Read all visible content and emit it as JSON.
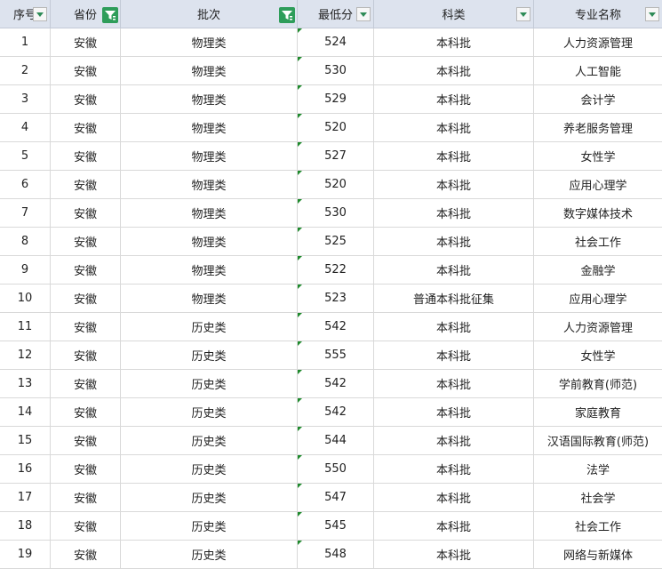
{
  "headers": [
    {
      "label": "序号",
      "control": "dropdown"
    },
    {
      "label": "省份",
      "control": "filter"
    },
    {
      "label": "批次",
      "control": "filter"
    },
    {
      "label": "最低分",
      "control": "dropdown"
    },
    {
      "label": "科类",
      "control": "dropdown"
    },
    {
      "label": "专业名称",
      "control": "dropdown"
    }
  ],
  "icons": {
    "dropdown": "dropdown-arrow-icon",
    "filter": "filter-active-icon"
  },
  "colors": {
    "header_bg": "#dde3ee",
    "filter_green": "#2e9d5a",
    "number_marker": "#1e8a2c"
  },
  "rows": [
    [
      "1",
      "安徽",
      "物理类",
      "524",
      "本科批",
      "人力资源管理"
    ],
    [
      "2",
      "安徽",
      "物理类",
      "530",
      "本科批",
      "人工智能"
    ],
    [
      "3",
      "安徽",
      "物理类",
      "529",
      "本科批",
      "会计学"
    ],
    [
      "4",
      "安徽",
      "物理类",
      "520",
      "本科批",
      "养老服务管理"
    ],
    [
      "5",
      "安徽",
      "物理类",
      "527",
      "本科批",
      "女性学"
    ],
    [
      "6",
      "安徽",
      "物理类",
      "520",
      "本科批",
      "应用心理学"
    ],
    [
      "7",
      "安徽",
      "物理类",
      "530",
      "本科批",
      "数字媒体技术"
    ],
    [
      "8",
      "安徽",
      "物理类",
      "525",
      "本科批",
      "社会工作"
    ],
    [
      "9",
      "安徽",
      "物理类",
      "522",
      "本科批",
      "金融学"
    ],
    [
      "10",
      "安徽",
      "物理类",
      "523",
      "普通本科批征集",
      "应用心理学"
    ],
    [
      "11",
      "安徽",
      "历史类",
      "542",
      "本科批",
      "人力资源管理"
    ],
    [
      "12",
      "安徽",
      "历史类",
      "555",
      "本科批",
      "女性学"
    ],
    [
      "13",
      "安徽",
      "历史类",
      "542",
      "本科批",
      "学前教育(师范)"
    ],
    [
      "14",
      "安徽",
      "历史类",
      "542",
      "本科批",
      "家庭教育"
    ],
    [
      "15",
      "安徽",
      "历史类",
      "544",
      "本科批",
      "汉语国际教育(师范)"
    ],
    [
      "16",
      "安徽",
      "历史类",
      "550",
      "本科批",
      "法学"
    ],
    [
      "17",
      "安徽",
      "历史类",
      "547",
      "本科批",
      "社会学"
    ],
    [
      "18",
      "安徽",
      "历史类",
      "545",
      "本科批",
      "社会工作"
    ],
    [
      "19",
      "安徽",
      "历史类",
      "548",
      "本科批",
      "网络与新媒体"
    ]
  ]
}
